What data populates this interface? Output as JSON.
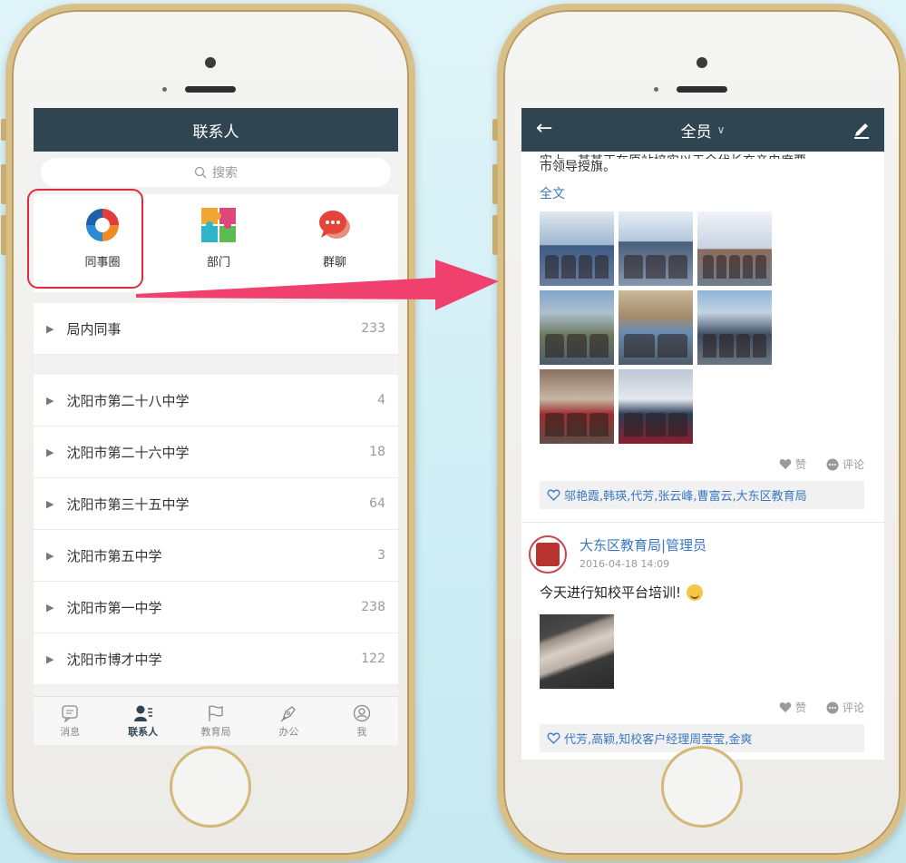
{
  "left_screen": {
    "title": "联系人",
    "search_placeholder": "搜索",
    "quick_actions": [
      {
        "label": "同事圈",
        "icon": "colleague-circle-icon"
      },
      {
        "label": "部门",
        "icon": "puzzle-icon"
      },
      {
        "label": "群聊",
        "icon": "chat-bubble-icon"
      }
    ],
    "groups": [
      {
        "name": "局内同事",
        "count": "233"
      }
    ],
    "schools": [
      {
        "name": "沈阳市第二十八中学",
        "count": "4"
      },
      {
        "name": "沈阳市第二十六中学",
        "count": "18"
      },
      {
        "name": "沈阳市第三十五中学",
        "count": "64"
      },
      {
        "name": "沈阳市第五中学",
        "count": "3"
      },
      {
        "name": "沈阳市第一中学",
        "count": "238"
      },
      {
        "name": "沈阳市博才中学",
        "count": "122"
      }
    ],
    "tabs": [
      {
        "label": "消息",
        "icon": "message-icon",
        "active": false
      },
      {
        "label": "联系人",
        "icon": "contacts-icon",
        "active": true
      },
      {
        "label": "教育局",
        "icon": "flag-icon",
        "active": false
      },
      {
        "label": "办公",
        "icon": "pen-icon",
        "active": false
      },
      {
        "label": "我",
        "icon": "profile-icon",
        "active": false
      }
    ]
  },
  "right_screen": {
    "title": "全员",
    "post1": {
      "cut_text": "实上，某某正在原站培实以于全代长充亲电度要",
      "text_tail": "市领导授旗。",
      "full_text_link": "全文",
      "like_label": "赞",
      "comment_label": "评论",
      "liked_by": "邬艳霞,韩瑛,代芳,张云峰,曹富云,大东区教育局"
    },
    "post2": {
      "author": "大东区教育局|管理员",
      "time": "2016-04-18 14:09",
      "text": "今天进行知校平台培训!",
      "like_label": "赞",
      "comment_label": "评论",
      "liked_by": "代芳,高颖,知校客户经理周莹莹,金爽"
    }
  },
  "colors": {
    "nav_bar": "#2f4551",
    "link_blue": "#3a78c3",
    "highlight_red": "#e02b3c",
    "arrow_pink": "#f0406e",
    "phone_gold": "#d9c08a"
  }
}
